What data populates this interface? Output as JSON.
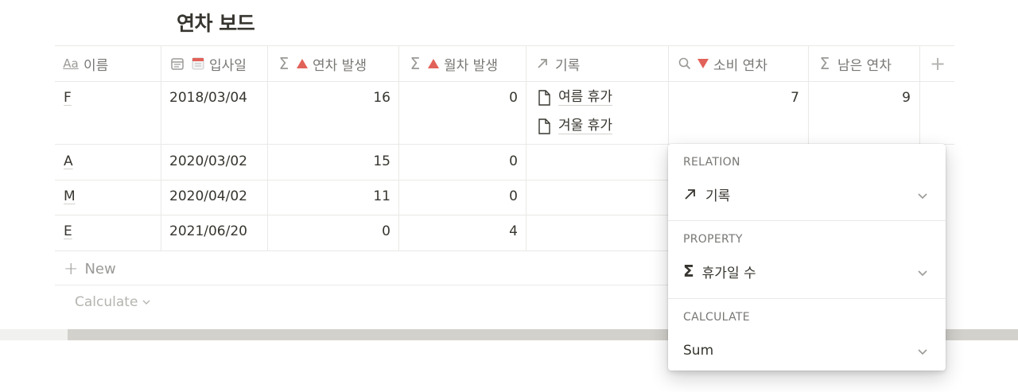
{
  "page": {
    "title": "연차 보드"
  },
  "table": {
    "columns": [
      {
        "label": "이름",
        "icon": "text-type-icon"
      },
      {
        "label": "입사일",
        "icon": "date-icon",
        "emoji": "calendar-emoji-icon"
      },
      {
        "label": "연차 발생",
        "icon": "sigma-icon",
        "marker": "red-triangle-up"
      },
      {
        "label": "월차 발생",
        "icon": "sigma-icon",
        "marker": "red-triangle-up"
      },
      {
        "label": "기록",
        "icon": "relation-arrow-icon"
      },
      {
        "label": "소비 연차",
        "icon": "search-icon",
        "marker": "red-triangle-down"
      },
      {
        "label": "남은 연차",
        "icon": "sigma-icon"
      }
    ],
    "add_column": "+",
    "rows": [
      {
        "name": "F",
        "date": "2018/03/04",
        "annual": "16",
        "monthly": "0",
        "records": [
          "여름 휴가",
          "겨울 휴가"
        ],
        "used": "7",
        "remaining": "9"
      },
      {
        "name": "A",
        "date": "2020/03/02",
        "annual": "15",
        "monthly": "0",
        "records": [],
        "used": "",
        "remaining": ""
      },
      {
        "name": "M",
        "date": "2020/04/02",
        "annual": "11",
        "monthly": "0",
        "records": [],
        "used": "",
        "remaining": ""
      },
      {
        "name": "E",
        "date": "2021/06/20",
        "annual": "0",
        "monthly": "4",
        "records": [],
        "used": "",
        "remaining": ""
      }
    ],
    "new_row": "New",
    "calculate": "Calculate"
  },
  "popover": {
    "relation_label": "RELATION",
    "relation_value": "기록",
    "property_label": "PROPERTY",
    "property_value": "휴가일 수",
    "calculate_label": "CALCULATE",
    "calculate_value": "Sum"
  },
  "colors": {
    "accent_red": "#e16259",
    "text": "#37352f",
    "muted": "#787774",
    "border": "#e9e9e7"
  }
}
